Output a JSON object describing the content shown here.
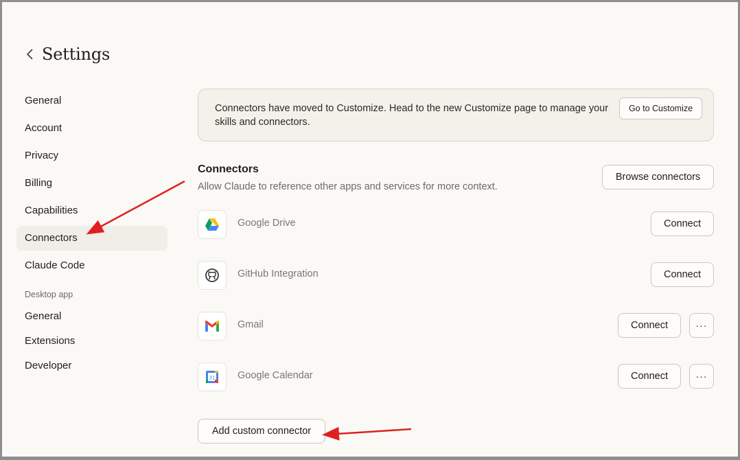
{
  "header": {
    "title": "Settings"
  },
  "sidebar": {
    "items": [
      {
        "label": "General"
      },
      {
        "label": "Account"
      },
      {
        "label": "Privacy"
      },
      {
        "label": "Billing"
      },
      {
        "label": "Capabilities"
      },
      {
        "label": "Connectors",
        "active": true
      },
      {
        "label": "Claude Code"
      }
    ],
    "desktop_section_label": "Desktop app",
    "desktop_items": [
      {
        "label": "General"
      },
      {
        "label": "Extensions"
      },
      {
        "label": "Developer"
      }
    ]
  },
  "banner": {
    "text": "Connectors have moved to Customize. Head to the new Customize page to manage your skills and connectors.",
    "button_label": "Go to Customize"
  },
  "connectors": {
    "title": "Connectors",
    "description": "Allow Claude to reference other apps and services for more context.",
    "browse_label": "Browse connectors",
    "items": [
      {
        "name": "Google Drive",
        "icon": "google-drive-icon",
        "action_label": "Connect"
      },
      {
        "name": "GitHub Integration",
        "icon": "github-icon",
        "action_label": "Connect"
      },
      {
        "name": "Gmail",
        "icon": "gmail-icon",
        "action_label": "Connect",
        "more_label": "···"
      },
      {
        "name": "Google Calendar",
        "icon": "google-calendar-icon",
        "action_label": "Connect",
        "more_label": "···",
        "icon_text": "31"
      }
    ],
    "add_custom_label": "Add custom connector"
  },
  "colors": {
    "background": "#faf9f5",
    "active_nav": "#f0eee6",
    "annotation_arrow": "#e02020"
  }
}
